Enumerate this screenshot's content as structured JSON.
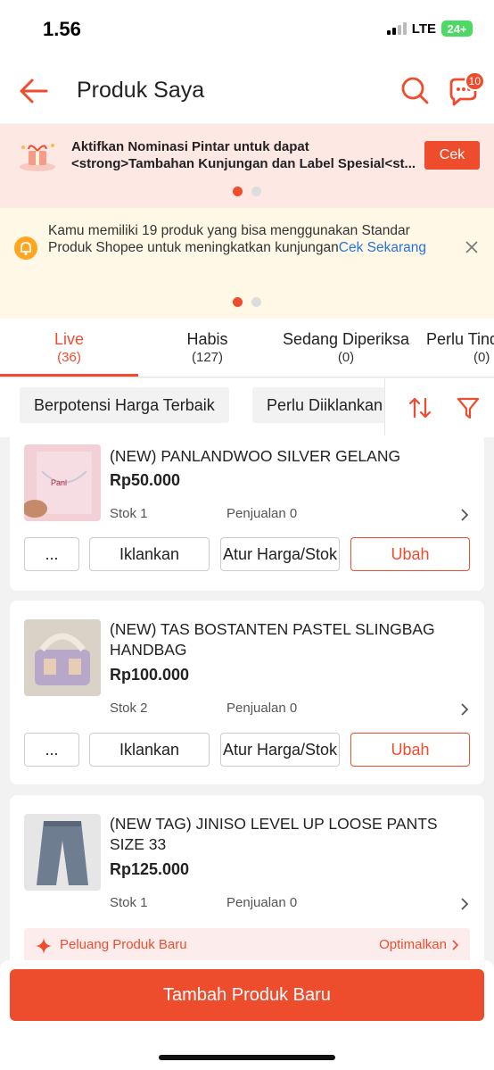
{
  "status_bar": {
    "time": "1.56",
    "network": "LTE",
    "battery": "24+"
  },
  "header": {
    "title": "Produk Saya",
    "chat_badge": "10"
  },
  "promo": {
    "line1": "Aktifkan Nominasi Pintar untuk dapat",
    "line2": "<strong>Tambahan Kunjungan dan Label Spesial<st...",
    "button": "Cek"
  },
  "notice": {
    "text": "Kamu memiliki 19 produk yang bisa menggunakan Standar Produk Shopee untuk meningkatkan kunjungan",
    "link": "Cek Sekarang"
  },
  "tabs": [
    {
      "label": "Live",
      "count": "(36)"
    },
    {
      "label": "Habis",
      "count": "(127)"
    },
    {
      "label": "Sedang Diperiksa",
      "count": "(0)"
    },
    {
      "label": "Perlu Tindakan",
      "count": "(0)"
    }
  ],
  "filters": [
    "Berpotensi Harga Terbaik",
    "Perlu Diiklankan"
  ],
  "products": [
    {
      "name": "(NEW) PANLANDWOO SILVER GELANG",
      "price": "Rp50.000",
      "stock": "Stok 1",
      "sales": "Penjualan 0"
    },
    {
      "name": "(NEW) TAS BOSTANTEN PASTEL SLINGBAG HANDBAG",
      "price": "Rp100.000",
      "stock": "Stok 2",
      "sales": "Penjualan 0"
    },
    {
      "name": "(NEW TAG) JINISO LEVEL UP LOOSE PANTS SIZE 33",
      "price": "Rp125.000",
      "stock": "Stok 1",
      "sales": "Penjualan 0"
    }
  ],
  "actions": {
    "more": "...",
    "ads": "Iklankan",
    "price_stock": "Atur Harga/Stok",
    "edit": "Ubah"
  },
  "opportunity": {
    "label": "Peluang Produk Baru",
    "action": "Optimalkan"
  },
  "cta": "Tambah Produk Baru",
  "colors": {
    "accent": "#ee4d2d",
    "link": "#2673dd"
  }
}
